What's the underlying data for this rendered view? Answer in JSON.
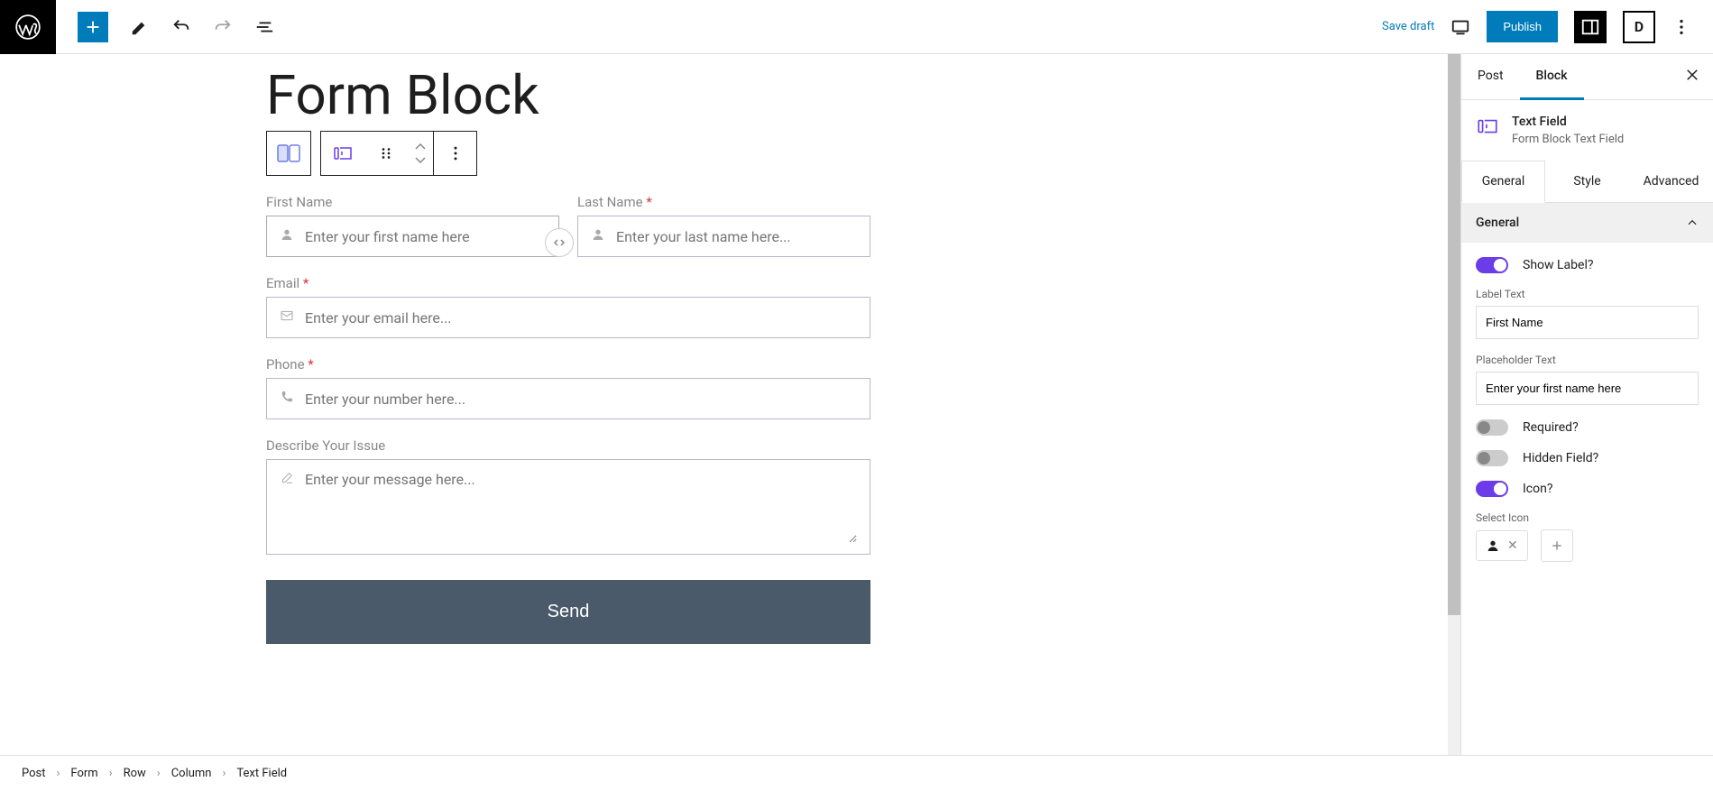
{
  "topbar": {
    "save_draft": "Save draft",
    "publish": "Publish"
  },
  "page": {
    "title": "Form Block"
  },
  "form": {
    "first_name": {
      "label": "First Name",
      "placeholder": "Enter your first name here"
    },
    "last_name": {
      "label": "Last Name",
      "placeholder": "Enter your last name here..."
    },
    "email": {
      "label": "Email",
      "placeholder": "Enter your email here..."
    },
    "phone": {
      "label": "Phone",
      "placeholder": "Enter your number here..."
    },
    "describe": {
      "label": "Describe Your Issue",
      "placeholder": "Enter your message here..."
    },
    "submit": "Send"
  },
  "sidebar": {
    "tabs": {
      "post": "Post",
      "block": "Block"
    },
    "block_name": "Text Field",
    "block_desc": "Form Block Text Field",
    "sub_tabs": {
      "general": "General",
      "style": "Style",
      "advanced": "Advanced"
    },
    "panel": {
      "title": "General",
      "show_label": "Show Label?",
      "label_text_label": "Label Text",
      "label_text_value": "First Name",
      "placeholder_label": "Placeholder Text",
      "placeholder_value": "Enter your first name here",
      "required": "Required?",
      "hidden": "Hidden Field?",
      "icon": "Icon?",
      "select_icon": "Select Icon"
    }
  },
  "breadcrumbs": [
    "Post",
    "Form",
    "Row",
    "Column",
    "Text Field"
  ]
}
